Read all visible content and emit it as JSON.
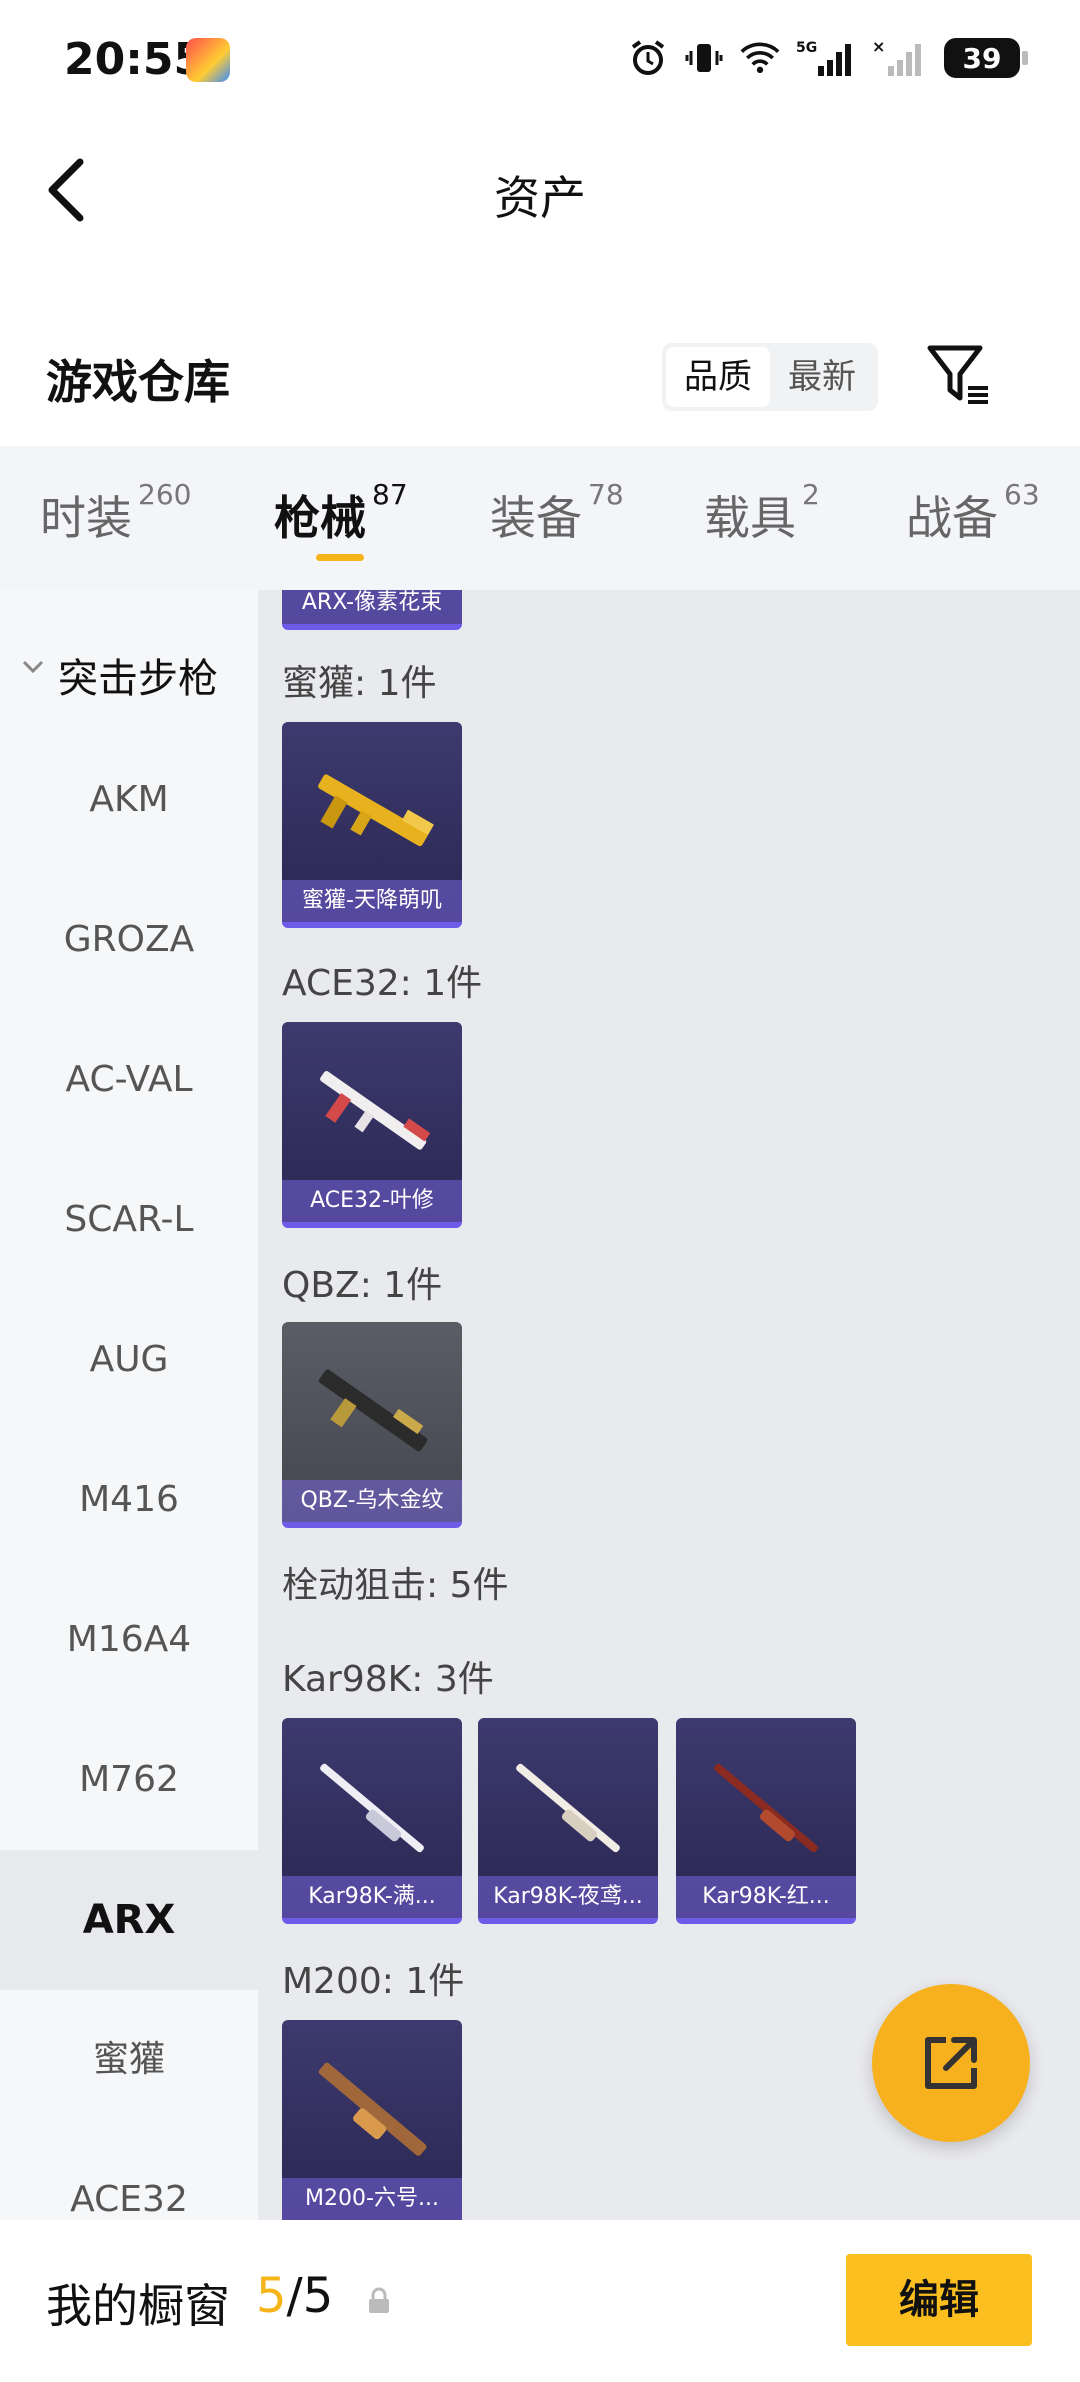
{
  "status_bar": {
    "time": "20:55",
    "battery": "39",
    "network": "5G"
  },
  "nav": {
    "title": "资产"
  },
  "warehouse": {
    "title": "游戏仓库",
    "sort_options": [
      "品质",
      "最新"
    ],
    "active_sort": "品质"
  },
  "tabs": [
    {
      "label": "时装",
      "count": "260"
    },
    {
      "label": "枪械",
      "count": "87"
    },
    {
      "label": "装备",
      "count": "78"
    },
    {
      "label": "载具",
      "count": "2"
    },
    {
      "label": "战备",
      "count": "63"
    }
  ],
  "active_tab": "枪械",
  "sidebar": {
    "category": "突击步枪",
    "items": [
      "AKM",
      "GROZA",
      "AC-VAL",
      "SCAR-L",
      "AUG",
      "M416",
      "M16A4",
      "M762",
      "ARX",
      "蜜獾",
      "ACE32"
    ],
    "active_item": "ARX"
  },
  "content": {
    "top_partial_card": "ARX-像素花束",
    "groups": [
      {
        "title": "蜜獾: 1件",
        "cards": [
          {
            "name": "蜜獾-天降萌叽",
            "style": "gold"
          }
        ]
      },
      {
        "title": "ACE32: 1件",
        "cards": [
          {
            "name": "ACE32-叶修",
            "style": "white"
          }
        ]
      },
      {
        "title": "QBZ: 1件",
        "cards": [
          {
            "name": "QBZ-乌木金纹",
            "style": "grey"
          }
        ]
      },
      {
        "title": "栓动狙击: 5件",
        "cards": []
      },
      {
        "title": "Kar98K: 3件",
        "cards": [
          {
            "name": "Kar98K-满...",
            "style": "white"
          },
          {
            "name": "Kar98K-夜鸢...",
            "style": "white"
          },
          {
            "name": "Kar98K-红...",
            "style": "red"
          }
        ]
      },
      {
        "title": "M200: 1件",
        "cards": [
          {
            "name": "M200-六号...",
            "style": "bronze"
          }
        ]
      }
    ]
  },
  "bottom_bar": {
    "label": "我的橱窗",
    "current": "5",
    "separator": "/",
    "total": "5",
    "edit_label": "编辑"
  },
  "colors": {
    "accent": "#f5b417",
    "edit_button": "#fbc020",
    "card_bg": "#2f2c5e"
  }
}
